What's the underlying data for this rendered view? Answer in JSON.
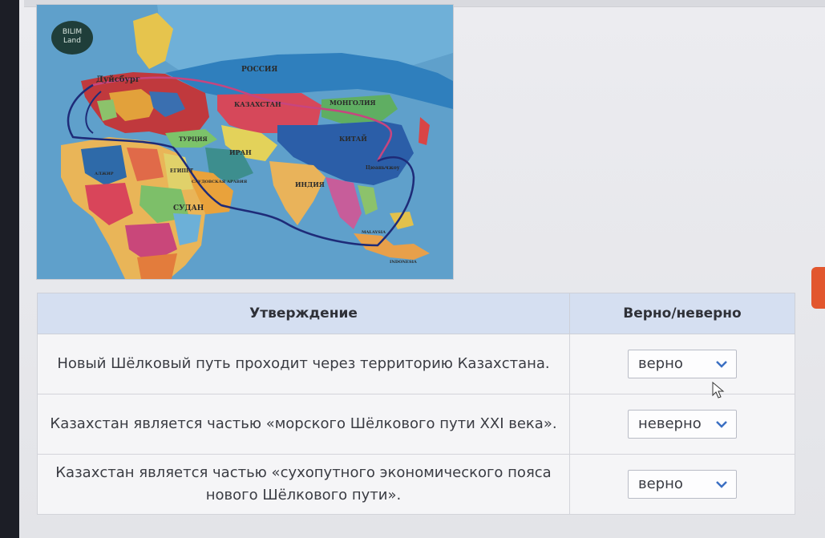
{
  "map": {
    "badge_line1": "BILIM",
    "badge_line2": "Land",
    "labels": {
      "duisburg": "Дуйсбург",
      "russia": "РОССИЯ",
      "kazakhstan": "КАЗАХСТАН",
      "mongolia": "МОНГОЛИЯ",
      "china": "КИТАЙ",
      "turkey": "ТУРЦИЯ",
      "iran": "ИРАН",
      "egypt": "ЕГИПЕТ",
      "india": "ИНДИЯ",
      "sudan": "СУДАН",
      "malaysia": "MALAYSIA",
      "indonesia": "INDONESIA",
      "saudi": "САУДОВСКАЯ АРАВИЯ",
      "chuanzhou": "Цюаньчжоу",
      "algeria": "АЛЖИР"
    }
  },
  "table": {
    "col_statement": "Утверждение",
    "col_truth": "Верно/неверно",
    "rows": [
      {
        "statement": "Новый Шёлковый путь проходит через территорию Казахстана.",
        "value": "верно"
      },
      {
        "statement": "Казахстан является частью «морского Шёлкового пути XXI века».",
        "value": "неверно"
      },
      {
        "statement": "Казахстан является частью «сухопутного экономического пояса нового Шёлкового пути».",
        "value": "верно"
      }
    ]
  },
  "colors": {
    "header_bg": "#d5dff1",
    "chevron": "#3b6fc2",
    "side_tab": "#e2562e",
    "route_land": "#c7457f",
    "route_sea": "#1e2b78"
  }
}
